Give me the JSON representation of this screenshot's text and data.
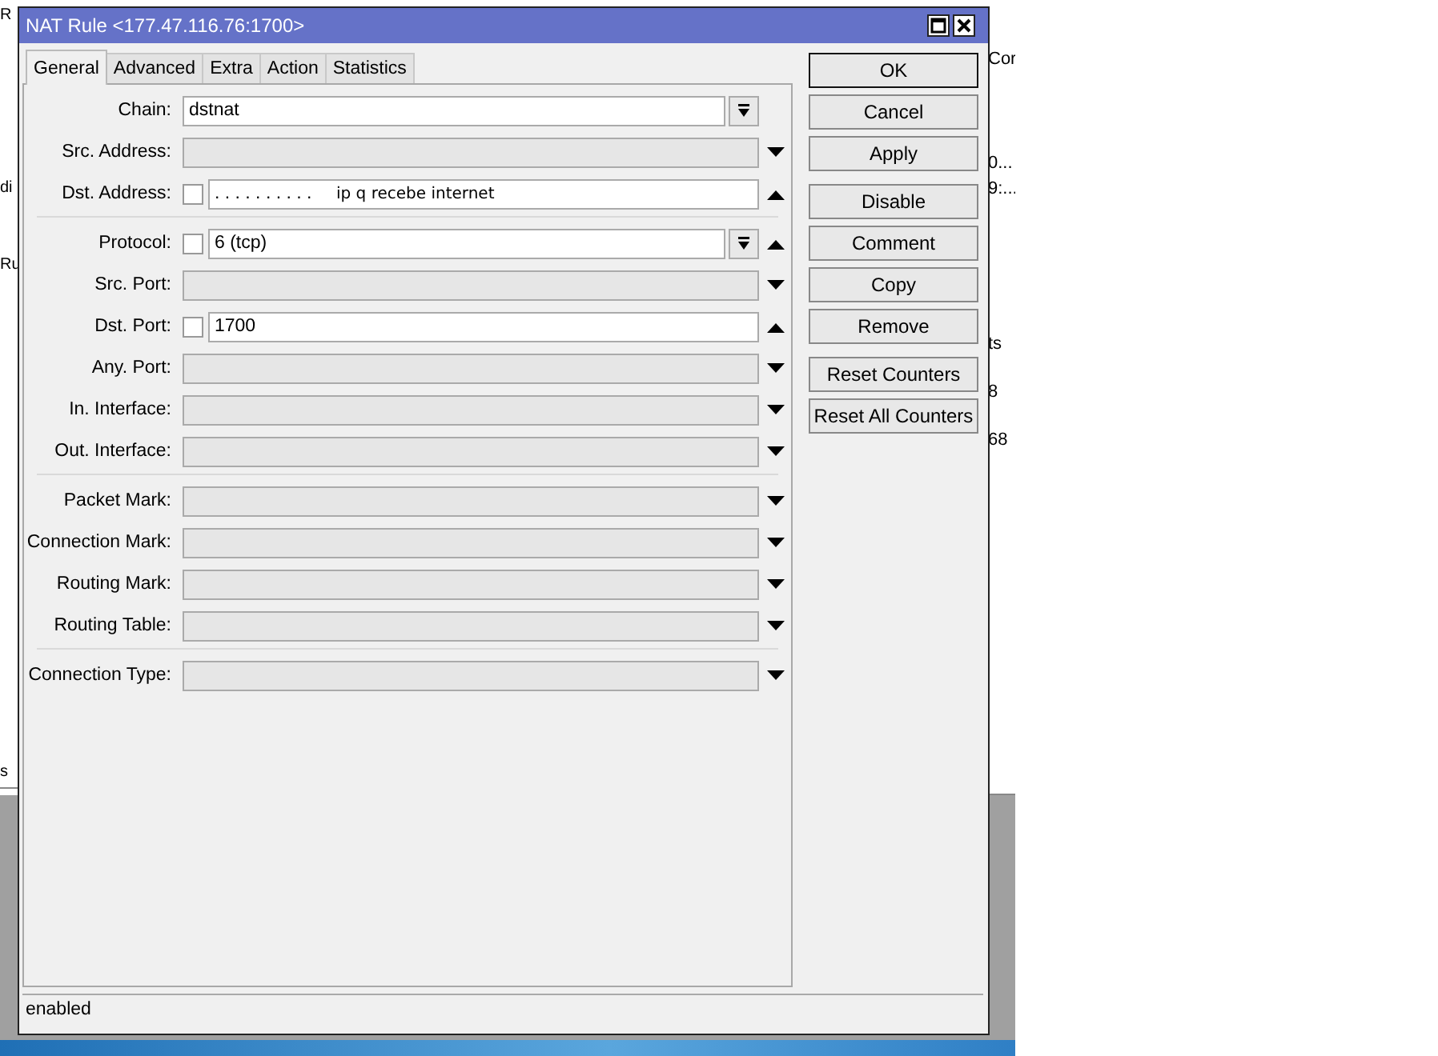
{
  "background": {
    "left_fragments": [
      "R",
      "di",
      "Ru",
      "s"
    ],
    "right_fragments": [
      "Cor",
      "0...",
      "9:...",
      "ts",
      "8",
      "68"
    ]
  },
  "window": {
    "title": "NAT Rule <177.47.116.76:1700>"
  },
  "tabs": [
    {
      "label": "General",
      "selected": true
    },
    {
      "label": "Advanced",
      "selected": false
    },
    {
      "label": "Extra",
      "selected": false
    },
    {
      "label": "Action",
      "selected": false
    },
    {
      "label": "Statistics",
      "selected": false
    }
  ],
  "sections": [
    {
      "fields": [
        {
          "kind": "combo",
          "label": "Chain:",
          "value": "dstnat"
        },
        {
          "kind": "select",
          "label": "Src. Address:"
        },
        {
          "kind": "check",
          "label": "Dst. Address:",
          "value": ". . . . . . . . . .",
          "note": "ip q recebe internet",
          "checked": false
        }
      ]
    },
    {
      "fields": [
        {
          "kind": "check-combo",
          "label": "Protocol:",
          "value": "6 (tcp)",
          "checked": false
        },
        {
          "kind": "select",
          "label": "Src. Port:"
        },
        {
          "kind": "check",
          "label": "Dst. Port:",
          "value": "1700",
          "checked": false
        },
        {
          "kind": "select",
          "label": "Any. Port:"
        },
        {
          "kind": "select",
          "label": "In. Interface:"
        },
        {
          "kind": "select",
          "label": "Out. Interface:"
        }
      ]
    },
    {
      "fields": [
        {
          "kind": "select",
          "label": "Packet Mark:"
        },
        {
          "kind": "select",
          "label": "Connection Mark:"
        },
        {
          "kind": "select",
          "label": "Routing Mark:"
        },
        {
          "kind": "select",
          "label": "Routing Table:"
        }
      ]
    },
    {
      "fields": [
        {
          "kind": "select",
          "label": "Connection Type:"
        }
      ]
    }
  ],
  "button_groups": [
    [
      {
        "label": "OK",
        "default": true
      },
      {
        "label": "Cancel",
        "default": false
      },
      {
        "label": "Apply",
        "default": false
      }
    ],
    [
      {
        "label": "Disable",
        "default": false
      },
      {
        "label": "Comment",
        "default": false
      },
      {
        "label": "Copy",
        "default": false
      },
      {
        "label": "Remove",
        "default": false
      }
    ],
    [
      {
        "label": "Reset Counters",
        "default": false
      },
      {
        "label": "Reset All Counters",
        "default": false
      }
    ]
  ],
  "status_bar": "enabled"
}
